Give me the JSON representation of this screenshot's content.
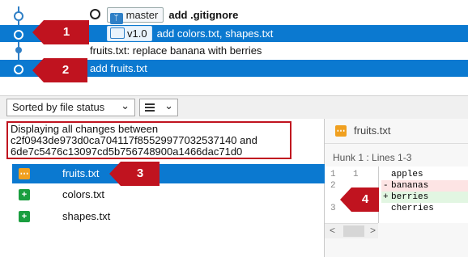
{
  "log": {
    "commits": [
      {
        "branch_label": "master",
        "message": "add .gitignore"
      },
      {
        "tag_label": "v1.0",
        "message": "add colors.txt, shapes.txt"
      },
      {
        "message": "fruits.txt: replace banana with berries"
      },
      {
        "message": "add fruits.txt"
      }
    ]
  },
  "callouts": [
    "1",
    "2",
    "3",
    "4"
  ],
  "toolbar": {
    "sort_label": "Sorted by file status",
    "sort_caret": "⌄",
    "view_caret": "⌄"
  },
  "changes": {
    "line1": "Displaying all changes between",
    "line2": "c2f0943de973d0ca704117f85529977032537140 and",
    "line3": "6de7c5476c13097cd5b756748900a1466dac71d0"
  },
  "files": [
    {
      "name": "fruits.txt",
      "status": "modified"
    },
    {
      "name": "colors.txt",
      "status": "added"
    },
    {
      "name": "shapes.txt",
      "status": "added"
    }
  ],
  "diff": {
    "file": "fruits.txt",
    "hunk": "Hunk 1 : Lines 1-3",
    "lines": [
      {
        "old": "1",
        "new": "1",
        "sign": " ",
        "text": "apples"
      },
      {
        "old": "2",
        "new": "",
        "sign": "-",
        "text": "bananas"
      },
      {
        "old": "",
        "new": "2",
        "sign": "+",
        "text": "berries"
      },
      {
        "old": "3",
        "new": "3",
        "sign": " ",
        "text": "cherries"
      }
    ],
    "scroll_left": "<",
    "scroll_right": ">"
  },
  "colors": {
    "selection": "#0b79d0",
    "callout": "#c0131f",
    "added": "#1a9e3f",
    "modified": "#f0a020"
  }
}
